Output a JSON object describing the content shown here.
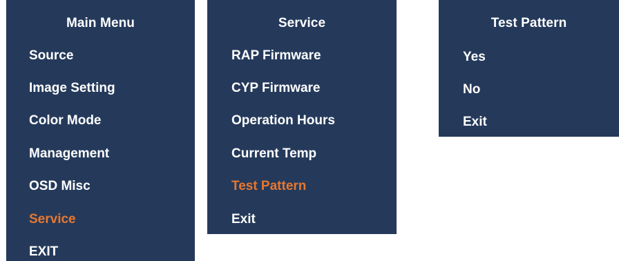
{
  "main_menu": {
    "title": "Main Menu",
    "items": [
      {
        "label": "Source"
      },
      {
        "label": "Image Setting"
      },
      {
        "label": "Color Mode"
      },
      {
        "label": "Management"
      },
      {
        "label": "OSD Misc"
      },
      {
        "label": "Service",
        "selected": true
      },
      {
        "label": "EXIT"
      }
    ]
  },
  "service_menu": {
    "title": "Service",
    "items": [
      {
        "label": "RAP Firmware"
      },
      {
        "label": "CYP Firmware"
      },
      {
        "label": "Operation Hours"
      },
      {
        "label": "Current Temp"
      },
      {
        "label": "Test Pattern",
        "selected": true
      },
      {
        "label": "Exit"
      }
    ]
  },
  "test_pattern_menu": {
    "title": "Test Pattern",
    "items": [
      {
        "label": "Yes"
      },
      {
        "label": "No"
      },
      {
        "label": "Exit"
      }
    ]
  },
  "colors": {
    "panel_background": "#253a5b",
    "text": "#ffffff",
    "selected_text": "#e8772e"
  }
}
